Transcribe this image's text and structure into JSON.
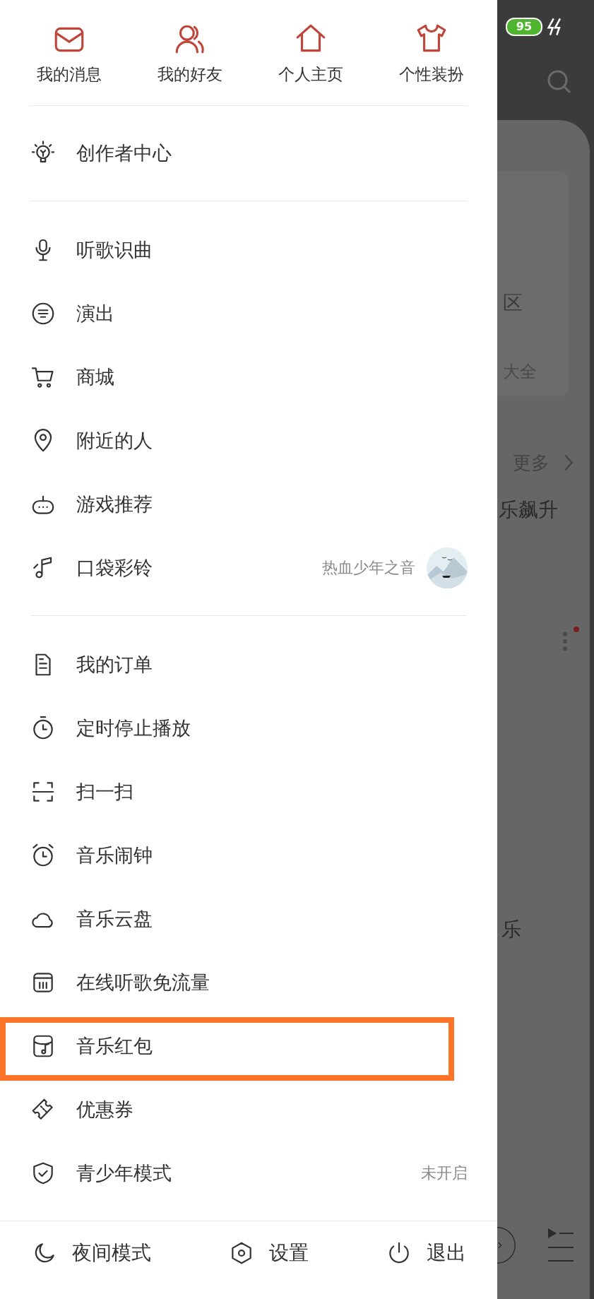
{
  "status_bar": {
    "battery": "95"
  },
  "shortcuts": [
    {
      "label": "我的消息"
    },
    {
      "label": "我的好友"
    },
    {
      "label": "个人主页"
    },
    {
      "label": "个性装扮"
    }
  ],
  "sections": [
    {
      "items": [
        {
          "label": "创作者中心",
          "highlighted": false
        }
      ]
    },
    {
      "items": [
        {
          "label": "听歌识曲",
          "highlighted": false
        },
        {
          "label": "演出",
          "highlighted": false
        },
        {
          "label": "商城",
          "highlighted": false
        },
        {
          "label": "附近的人",
          "highlighted": false
        },
        {
          "label": "游戏推荐",
          "highlighted": false
        },
        {
          "label": "口袋彩铃",
          "value": "热血少年之音",
          "highlighted": false
        }
      ]
    },
    {
      "items": [
        {
          "label": "我的订单",
          "highlighted": false
        },
        {
          "label": "定时停止播放",
          "highlighted": false
        },
        {
          "label": "扫一扫",
          "highlighted": false
        },
        {
          "label": "音乐闹钟",
          "highlighted": false
        },
        {
          "label": "音乐云盘",
          "highlighted": false
        },
        {
          "label": "在线听歌免流量",
          "highlighted": false
        },
        {
          "label": "音乐红包",
          "highlighted": true
        },
        {
          "label": "优惠券",
          "highlighted": false
        },
        {
          "label": "青少年模式",
          "value": "未开启",
          "highlighted": false
        }
      ]
    }
  ],
  "bottom_bar": [
    {
      "label": "夜间模式"
    },
    {
      "label": "设置"
    },
    {
      "label": "退出"
    }
  ],
  "background": {
    "texts": [
      "区",
      "大全",
      "更多",
      "乐飙升",
      "乐"
    ]
  }
}
